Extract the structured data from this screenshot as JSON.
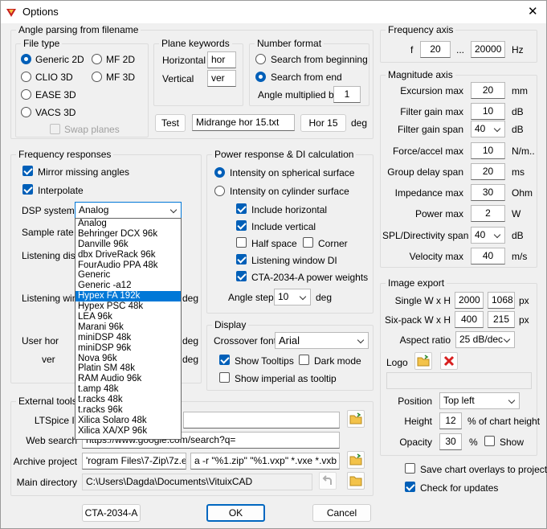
{
  "window": {
    "title": "Options",
    "close": "✕"
  },
  "angle": {
    "group": "Angle parsing from filename",
    "filetype_group": "File type",
    "generic2d": "Generic 2D",
    "mf2d": "MF 2D",
    "clio3d": "CLIO 3D",
    "mf3d": "MF 3D",
    "ease3d": "EASE 3D",
    "vacs3d": "VACS 3D",
    "swap": "Swap planes",
    "plane_group": "Plane keywords",
    "horizontal": "Horizontal",
    "horizontal_val": "hor",
    "vertical": "Vertical",
    "vertical_val": "ver",
    "number_group": "Number format",
    "from_begin": "Search from beginning",
    "from_end": "Search from end",
    "multiplied": "Angle multiplied by",
    "multiplied_val": "1",
    "test_btn": "Test",
    "test_file": "Midrange hor 15.txt",
    "result": "Hor 15",
    "deg": "deg"
  },
  "freqaxis": {
    "group": "Frequency axis",
    "f": "f",
    "from": "20",
    "dots": "...",
    "to": "20000",
    "unit": "Hz"
  },
  "mag": {
    "group": "Magnitude axis",
    "rows": [
      {
        "label": "Excursion max",
        "value": "20",
        "unit": "mm"
      },
      {
        "label": "Filter gain max",
        "value": "10",
        "unit": "dB"
      },
      {
        "label": "Filter gain span",
        "value": "40",
        "unit": "dB"
      },
      {
        "label": "Force/accel max",
        "value": "10",
        "unit": "N/m.."
      },
      {
        "label": "Group delay span",
        "value": "20",
        "unit": "ms"
      },
      {
        "label": "Impedance max",
        "value": "30",
        "unit": "Ohm"
      },
      {
        "label": "Power max",
        "value": "2",
        "unit": "W"
      },
      {
        "label": "SPL/Directivity span",
        "value": "40",
        "unit": "dB"
      },
      {
        "label": "Velocity max",
        "value": "40",
        "unit": "m/s"
      }
    ]
  },
  "fr": {
    "group": "Frequency responses",
    "mirror": "Mirror missing angles",
    "interp": "Interpolate",
    "dsp": "DSP system",
    "dsp_val": "Analog",
    "sample": "Sample rate",
    "listen_dist": "Listening dista",
    "listen_wind": "Listening wind",
    "user_hor": "User hor",
    "ver": "ver",
    "deg": "deg"
  },
  "dsp_list": [
    "Analog",
    "Behringer DCX 96k",
    "Danville 96k",
    "dbx DriveRack 96k",
    "FourAudio PPA 48k",
    "Generic",
    "Generic -a12",
    "Hypex FA 192k",
    "Hypex PSC 48k",
    "LEA 96k",
    "Marani 96k",
    "miniDSP 48k",
    "miniDSP 96k",
    "Nova 96k",
    "Platin SM 48k",
    "RAM Audio 96k",
    "t.amp 48k",
    "t.racks 48k",
    "t.racks 96k",
    "Xilica Solaro 48k",
    "Xilica XA/XP 96k"
  ],
  "power": {
    "group": "Power response & DI calculation",
    "spherical": "Intensity on spherical surface",
    "cylinder": "Intensity on cylinder surface",
    "inc_h": "Include horizontal",
    "inc_v": "Include vertical",
    "half": "Half space",
    "corner": "Corner",
    "lwdi": "Listening window DI",
    "cta": "CTA-2034-A power weights",
    "step": "Angle step",
    "step_val": "10",
    "deg": "deg"
  },
  "display": {
    "group": "Display",
    "xfont": "Crossover font",
    "xfont_val": "Arial",
    "tooltips": "Show Tooltips",
    "dark": "Dark mode",
    "imperial": "Show imperial as tooltip"
  },
  "export": {
    "group": "Image export",
    "single": "Single W x H",
    "single_w": "2000",
    "single_h": "1068",
    "six": "Six-pack W x H",
    "six_w": "400",
    "six_h": "215",
    "px": "px",
    "aspect": "Aspect ratio",
    "aspect_val": "25 dB/dec",
    "logo": "Logo",
    "position": "Position",
    "position_val": "Top left",
    "height": "Height",
    "height_val": "12",
    "height_unit": "% of chart height",
    "opacity": "Opacity",
    "opacity_val": "30",
    "pct": "%",
    "show": "Show"
  },
  "misc": {
    "save_overlays": "Save chart overlays to project",
    "check_updates": "Check for updates"
  },
  "tools": {
    "group": "External tools a",
    "ltspice": "LTSpice I\\",
    "web": "Web search",
    "web_val": "https://www.google.com/search?q=",
    "archive": "Archive project",
    "archive_path": "'rogram Files\\7-Zip\\7z.exe",
    "archive_args": "a -r \"%1.zip\" \"%1.vxp\" *.vxe *.vxb *.vx",
    "main": "Main directory",
    "main_val": "C:\\Users\\Dagda\\Documents\\VituixCAD"
  },
  "buttons": {
    "cta": "CTA-2034-A",
    "ok": "OK",
    "cancel": "Cancel"
  }
}
